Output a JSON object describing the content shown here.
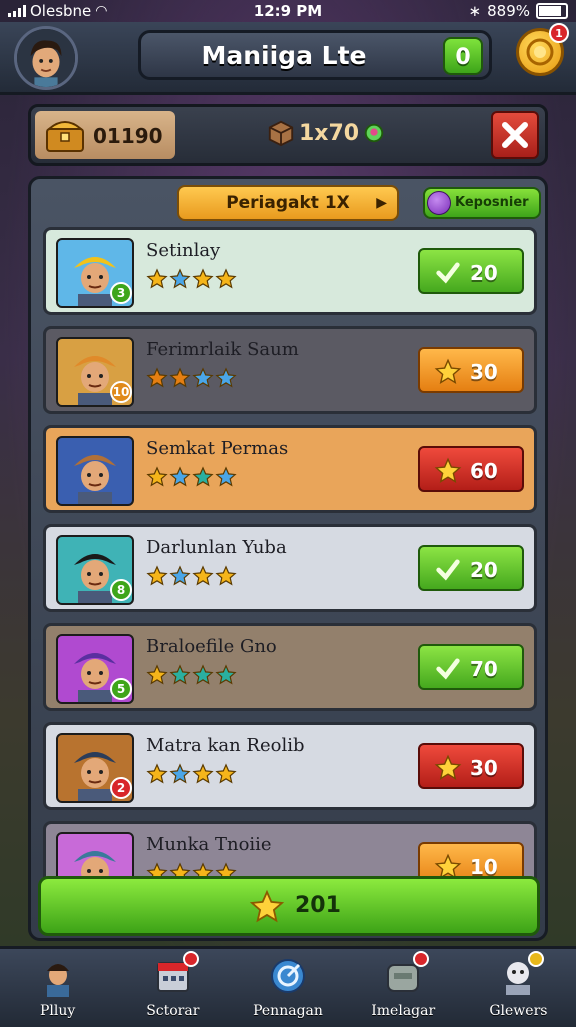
{
  "status_bar": {
    "carrier": "Olesbne",
    "time": "12:9 PM",
    "battery": "889%"
  },
  "header": {
    "title": "Maniiga Lte",
    "notif_count": "0",
    "coin_badge": "1"
  },
  "resources": {
    "currency": "01190",
    "multiplier": "1x70"
  },
  "panel": {
    "tab_label": "Periagakt 1X",
    "side_label": "Keposnier"
  },
  "rows": [
    {
      "name": "Setinlay",
      "action": "20",
      "stars": [
        "gold",
        "blue",
        "gold",
        "gold"
      ],
      "color": "green",
      "bg": "#d7e9dc",
      "level": "3"
    },
    {
      "name": "Ferimrlaik Saum",
      "action": "30",
      "stars": [
        "orange",
        "orange",
        "blue",
        "blue"
      ],
      "color": "orange",
      "bg": "#5b5a63",
      "level": "10"
    },
    {
      "name": "Semkat Permas",
      "action": "60",
      "stars": [
        "gold",
        "blue",
        "teal",
        "blue"
      ],
      "color": "red",
      "bg": "#e9a55a",
      "level": ""
    },
    {
      "name": "Darlunlan Yuba",
      "action": "20",
      "stars": [
        "gold",
        "blue",
        "gold",
        "gold"
      ],
      "color": "green",
      "bg": "#d6dae2",
      "level": "8"
    },
    {
      "name": "Braloefile Gno",
      "action": "70",
      "stars": [
        "gold",
        "teal",
        "teal",
        "teal"
      ],
      "color": "green",
      "bg": "#93806c",
      "level": "5"
    },
    {
      "name": "Matra kan Reolib",
      "action": "30",
      "stars": [
        "gold",
        "blue",
        "gold",
        "gold"
      ],
      "color": "red",
      "bg": "#d6dae2",
      "level": "2"
    },
    {
      "name": "Munka Tnoiie",
      "action": "10",
      "stars": [
        "gold",
        "gold",
        "gold",
        "gold"
      ],
      "color": "orange",
      "bg": "#8e8696",
      "level": ""
    }
  ],
  "claim": {
    "label": "201"
  },
  "nav": [
    {
      "label": "Plluy",
      "badge": false
    },
    {
      "label": "Sctorar",
      "badge": true
    },
    {
      "label": "Pennagan",
      "badge": false
    },
    {
      "label": "Imelagar",
      "badge": true
    },
    {
      "label": "Glewers",
      "badge": true
    }
  ],
  "colors": {
    "green": "#45a81e",
    "orange": "#e57f12",
    "red": "#b31e18",
    "gold": "#f5b51a",
    "blue": "#4aa6e8",
    "teal": "#2ab0a0"
  },
  "icons": {
    "avatar": "avatar-icon",
    "coin": "coin-icon",
    "chest": "treasure-chest-icon",
    "close": "close-icon",
    "star": "star-icon",
    "check": "check-icon"
  }
}
